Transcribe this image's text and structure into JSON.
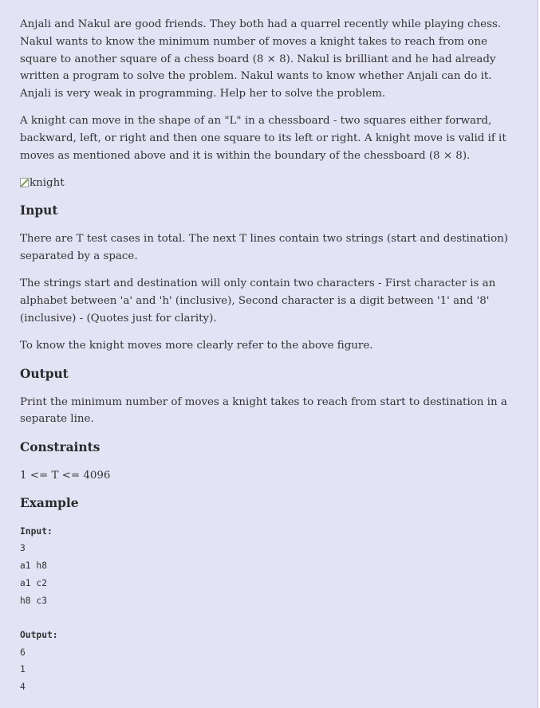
{
  "intro": "Anjali and Nakul are good friends. They both had a quarrel recently while playing chess. Nakul wants to know the minimum number of moves a knight takes to reach from one square to another square of a chess board (8 × 8). Nakul is brilliant and he had already written a program to solve the problem. Nakul wants to know whether Anjali can do it. Anjali is very weak in programming. Help her to solve the problem.",
  "knight_rule": "A knight can move in the shape of an \"L\" in a chessboard - two squares either forward, backward, left, or right and then one square to its left or right. A knight move is valid if it moves as mentioned above and it is within the boundary of the chessboard (8 × 8).",
  "image_alt": "knight",
  "input_section": {
    "heading": "Input",
    "para1": "There are T test cases in total. The next T lines contain two strings (start and destination) separated by a space.",
    "para2": "The strings start and destination will only contain two characters - First character is an alphabet between 'a' and 'h' (inclusive), Second character is a digit between '1' and '8' (inclusive) - (Quotes just for clarity).",
    "para3": "To know the knight moves more clearly refer to the above figure."
  },
  "output_section": {
    "heading": "Output",
    "para": "Print the minimum number of moves a knight takes to reach from start to destination in a separate line."
  },
  "constraints_section": {
    "heading": "Constraints",
    "text": "1 <= T <= 4096"
  },
  "example_section": {
    "heading": "Example",
    "input_label": "Input:",
    "input_lines": [
      "3",
      "a1 h8",
      "a1 c2",
      "h8 c3"
    ],
    "output_label": "Output:",
    "output_lines": [
      "6",
      "1",
      "4"
    ]
  }
}
